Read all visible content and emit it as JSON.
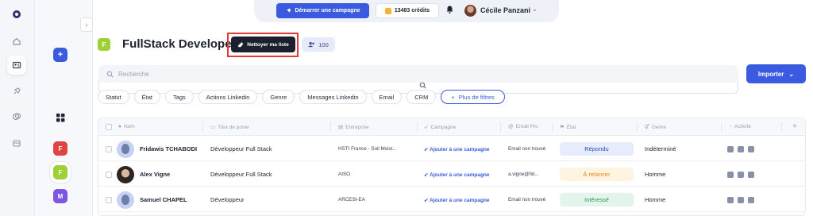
{
  "topbar": {
    "campaign_button": "Démarrer une campagne",
    "credits": "13483 crédits",
    "user_name": "Cécile Panzani"
  },
  "list_switcher": {
    "items": [
      "F",
      "F",
      "M"
    ]
  },
  "header": {
    "badge": "F",
    "title": "FullStack Developer",
    "clean_button": "Nettoyer ma liste",
    "count": "100"
  },
  "search": {
    "placeholder": "Recherche"
  },
  "import_button": "Importer",
  "filters": [
    "Statut",
    "État",
    "Tags",
    "Actions Linkedin",
    "Genre",
    "Messages Linkedin",
    "Email",
    "CRM"
  ],
  "more_filters": "Plus de filtres",
  "table": {
    "columns": [
      "Nom",
      "Titre de poste",
      "Entreprise",
      "Campagne",
      "Email Pro",
      "État",
      "Genre",
      "Activité"
    ],
    "rows": [
      {
        "name": "Fridawis TCHABODI",
        "title": "Développeur Full Stack",
        "company": "HSTI France - Soil Moist...",
        "campaign": "Ajouter à une campagne",
        "email": "Email non trouvé",
        "state": "Répondu",
        "gender": "Indéterminé"
      },
      {
        "name": "Alex Vigne",
        "title": "Développeur Full Stack",
        "company": "AISO",
        "campaign": "Ajouter à une campagne",
        "email": "a.vigne@fid...",
        "state": "À relancer",
        "gender": "Homme"
      },
      {
        "name": "Samuel CHAPEL",
        "title": "Développeur",
        "company": "ARCESI-EA",
        "campaign": "Ajouter à une campagne",
        "email": "Email non trouvé",
        "state": "Intéressé",
        "gender": "Homme"
      }
    ]
  },
  "colors": {
    "accent": "#3a5be0",
    "state_replied_bg": "#e6ecfb",
    "state_replied_fg": "#2f4fb8",
    "state_followup_bg": "#fff3e2",
    "state_followup_fg": "#e58a16",
    "state_interested_bg": "#e3f5ea",
    "state_interested_fg": "#2e9a5b"
  }
}
